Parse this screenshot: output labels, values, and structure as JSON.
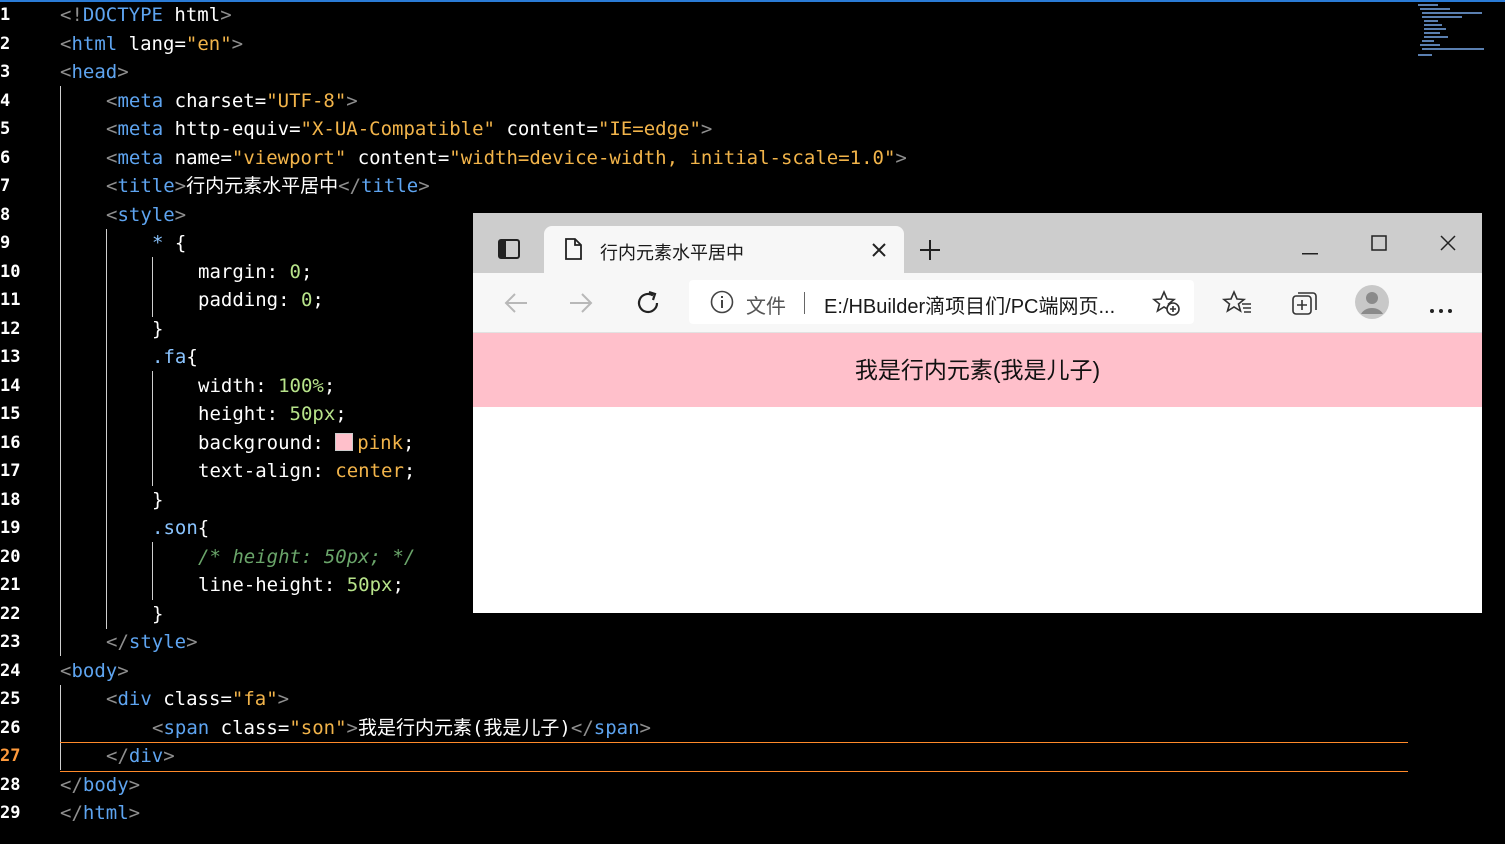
{
  "editor": {
    "active_line": 27,
    "lines": [
      {
        "num": "1",
        "segments": [
          [
            "bracket",
            "<!"
          ],
          [
            "tag",
            "DOCTYPE"
          ],
          [
            "plain",
            " "
          ],
          [
            "attr",
            "html"
          ],
          [
            "bracket",
            ">"
          ]
        ]
      },
      {
        "num": "2",
        "segments": [
          [
            "bracket",
            "<"
          ],
          [
            "tag",
            "html"
          ],
          [
            "plain",
            " "
          ],
          [
            "attr",
            "lang"
          ],
          [
            "plain",
            "="
          ],
          [
            "str",
            "\"en\""
          ],
          [
            "bracket",
            ">"
          ]
        ]
      },
      {
        "num": "3",
        "segments": [
          [
            "bracket",
            "<"
          ],
          [
            "tag",
            "head"
          ],
          [
            "bracket",
            ">"
          ]
        ]
      },
      {
        "num": "4",
        "segments": [
          [
            "bracket",
            "<"
          ],
          [
            "tag",
            "meta"
          ],
          [
            "plain",
            " "
          ],
          [
            "attr",
            "charset"
          ],
          [
            "plain",
            "="
          ],
          [
            "str",
            "\"UTF-8\""
          ],
          [
            "bracket",
            ">"
          ]
        ]
      },
      {
        "num": "5",
        "segments": [
          [
            "bracket",
            "<"
          ],
          [
            "tag",
            "meta"
          ],
          [
            "plain",
            " "
          ],
          [
            "attr",
            "http-equiv"
          ],
          [
            "plain",
            "="
          ],
          [
            "str",
            "\"X-UA-Compatible\""
          ],
          [
            "plain",
            " "
          ],
          [
            "attr",
            "content"
          ],
          [
            "plain",
            "="
          ],
          [
            "str",
            "\"IE=edge\""
          ],
          [
            "bracket",
            ">"
          ]
        ]
      },
      {
        "num": "6",
        "segments": [
          [
            "bracket",
            "<"
          ],
          [
            "tag",
            "meta"
          ],
          [
            "plain",
            " "
          ],
          [
            "attr",
            "name"
          ],
          [
            "plain",
            "="
          ],
          [
            "str",
            "\"viewport\""
          ],
          [
            "plain",
            " "
          ],
          [
            "attr",
            "content"
          ],
          [
            "plain",
            "="
          ],
          [
            "str",
            "\"width=device-width, initial-scale=1.0\""
          ],
          [
            "bracket",
            ">"
          ]
        ]
      },
      {
        "num": "7",
        "segments": [
          [
            "bracket",
            "<"
          ],
          [
            "tag",
            "title"
          ],
          [
            "bracket",
            ">"
          ],
          [
            "plain",
            "行内元素水平居中"
          ],
          [
            "bracket",
            "</"
          ],
          [
            "tag",
            "title"
          ],
          [
            "bracket",
            ">"
          ]
        ]
      },
      {
        "num": "8",
        "segments": [
          [
            "bracket",
            "<"
          ],
          [
            "tag",
            "style"
          ],
          [
            "bracket",
            ">"
          ]
        ]
      },
      {
        "num": "9",
        "segments": [
          [
            "sel",
            "*"
          ],
          [
            "plain",
            " {"
          ]
        ]
      },
      {
        "num": "10",
        "segments": [
          [
            "prop",
            "margin"
          ],
          [
            "plain",
            ": "
          ],
          [
            "num",
            "0"
          ],
          [
            "plain",
            ";"
          ]
        ]
      },
      {
        "num": "11",
        "segments": [
          [
            "prop",
            "padding"
          ],
          [
            "plain",
            ": "
          ],
          [
            "num",
            "0"
          ],
          [
            "plain",
            ";"
          ]
        ]
      },
      {
        "num": "12",
        "segments": [
          [
            "plain",
            "}"
          ]
        ]
      },
      {
        "num": "13",
        "segments": [
          [
            "sel",
            ".fa"
          ],
          [
            "plain",
            "{"
          ]
        ]
      },
      {
        "num": "14",
        "segments": [
          [
            "prop",
            "width"
          ],
          [
            "plain",
            ": "
          ],
          [
            "num",
            "100%"
          ],
          [
            "plain",
            ";"
          ]
        ]
      },
      {
        "num": "15",
        "segments": [
          [
            "prop",
            "height"
          ],
          [
            "plain",
            ": "
          ],
          [
            "num",
            "50px"
          ],
          [
            "plain",
            ";"
          ]
        ]
      },
      {
        "num": "16",
        "segments": [
          [
            "prop",
            "background"
          ],
          [
            "plain",
            ": "
          ],
          [
            "swatch",
            ""
          ],
          [
            "kw",
            "pink"
          ],
          [
            "plain",
            ";"
          ]
        ]
      },
      {
        "num": "17",
        "segments": [
          [
            "prop",
            "text-align"
          ],
          [
            "plain",
            ": "
          ],
          [
            "kw",
            "center"
          ],
          [
            "plain",
            ";"
          ]
        ]
      },
      {
        "num": "18",
        "segments": [
          [
            "plain",
            "}"
          ]
        ]
      },
      {
        "num": "19",
        "segments": [
          [
            "sel",
            ".son"
          ],
          [
            "plain",
            "{"
          ]
        ]
      },
      {
        "num": "20",
        "segments": [
          [
            "comment",
            "/* height: 50px; */"
          ]
        ]
      },
      {
        "num": "21",
        "segments": [
          [
            "prop",
            "line-height"
          ],
          [
            "plain",
            ": "
          ],
          [
            "num",
            "50px"
          ],
          [
            "plain",
            ";"
          ]
        ]
      },
      {
        "num": "22",
        "segments": [
          [
            "plain",
            "}"
          ]
        ]
      },
      {
        "num": "23",
        "segments": [
          [
            "bracket",
            "</"
          ],
          [
            "tag",
            "style"
          ],
          [
            "bracket",
            ">"
          ]
        ]
      },
      {
        "num": "24",
        "segments": [
          [
            "bracket",
            "<"
          ],
          [
            "tag",
            "body"
          ],
          [
            "bracket",
            ">"
          ]
        ]
      },
      {
        "num": "25",
        "segments": [
          [
            "bracket",
            "<"
          ],
          [
            "tag",
            "div"
          ],
          [
            "plain",
            " "
          ],
          [
            "attr",
            "class"
          ],
          [
            "plain",
            "="
          ],
          [
            "str",
            "\"fa\""
          ],
          [
            "bracket",
            ">"
          ]
        ]
      },
      {
        "num": "26",
        "segments": [
          [
            "bracket",
            "<"
          ],
          [
            "tag",
            "span"
          ],
          [
            "plain",
            " "
          ],
          [
            "attr",
            "class"
          ],
          [
            "plain",
            "="
          ],
          [
            "str",
            "\"son\""
          ],
          [
            "bracket",
            ">"
          ],
          [
            "plain",
            "我是行内元素(我是儿子)"
          ],
          [
            "bracket",
            "</"
          ],
          [
            "tag",
            "span"
          ],
          [
            "bracket",
            ">"
          ]
        ]
      },
      {
        "num": "27",
        "segments": [
          [
            "bracket",
            "</"
          ],
          [
            "tag",
            "div"
          ],
          [
            "bracket",
            ">"
          ]
        ]
      },
      {
        "num": "28",
        "segments": [
          [
            "bracket",
            "</"
          ],
          [
            "tag",
            "body"
          ],
          [
            "bracket",
            ">"
          ]
        ]
      },
      {
        "num": "29",
        "segments": [
          [
            "bracket",
            "</"
          ],
          [
            "tag",
            "html"
          ],
          [
            "bracket",
            ">"
          ]
        ]
      }
    ]
  },
  "browser": {
    "tab_title": "行内元素水平居中",
    "address_label": "文件",
    "address_url": "E:/HBuilder滴项目们/PC端网页...",
    "page_text": "我是行内元素(我是儿子)",
    "page_background": "#ffc0cb",
    "icons": {
      "sidebar_toggle": "sidebar-icon",
      "tab_page": "page-icon",
      "tab_close": "close-icon",
      "new_tab": "plus-icon",
      "minimize": "minimize-icon",
      "maximize": "maximize-icon",
      "close_window": "close-icon",
      "back": "arrow-left-icon",
      "forward": "arrow-right-icon",
      "refresh": "refresh-icon",
      "info": "info-icon",
      "favorite_add": "star-plus-icon",
      "favorites": "favorites-icon",
      "collections": "collections-icon",
      "profile": "avatar-icon",
      "more": "more-icon"
    }
  }
}
